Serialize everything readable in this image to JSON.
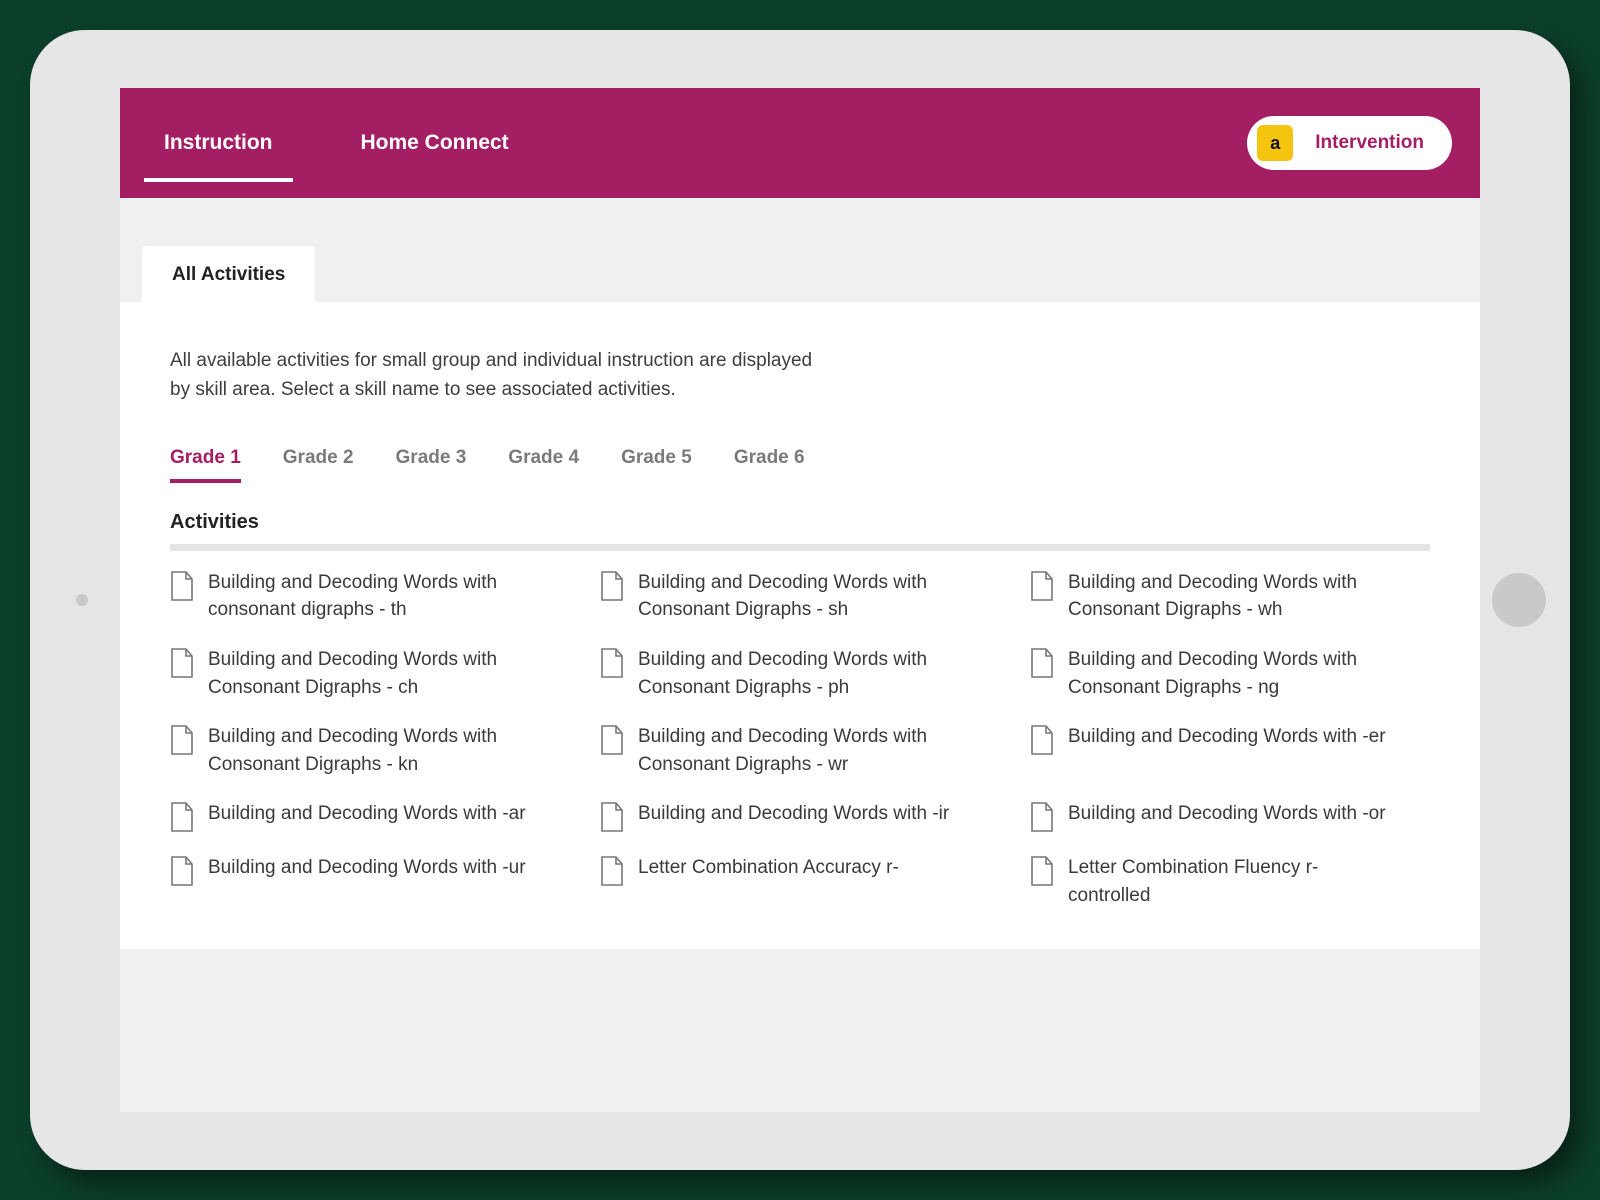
{
  "nav": {
    "tabs": [
      {
        "label": "Instruction",
        "active": true
      },
      {
        "label": "Home Connect",
        "active": false
      }
    ],
    "pill": {
      "badge": "a",
      "label": "Intervention"
    }
  },
  "subtab": {
    "label": "All Activities"
  },
  "intro": "All available activities for small group and individual instruction are displayed by skill area. Select a skill name to see associated activities.",
  "grades": [
    {
      "label": "Grade 1",
      "active": true
    },
    {
      "label": "Grade 2",
      "active": false
    },
    {
      "label": "Grade 3",
      "active": false
    },
    {
      "label": "Grade 4",
      "active": false
    },
    {
      "label": "Grade 5",
      "active": false
    },
    {
      "label": "Grade 6",
      "active": false
    }
  ],
  "section_title": "Activities",
  "activities": [
    "Building and Decoding Words with consonant digraphs - th",
    "Building and Decoding Words with Consonant Digraphs - sh",
    "Building and Decoding Words with Consonant Digraphs - wh",
    "Building and Decoding Words with Consonant Digraphs - ch",
    "Building and Decoding Words with Consonant Digraphs - ph",
    "Building and Decoding Words with Consonant Digraphs - ng",
    "Building and Decoding Words with Consonant Digraphs - kn",
    "Building and Decoding Words with Consonant Digraphs - wr",
    "Building and Decoding Words with -er",
    "Building and Decoding Words with -ar",
    "Building and Decoding Words with -ir",
    "Building and Decoding Words with -or",
    "Building and Decoding Words with -ur",
    "Letter Combination Accuracy r-",
    "Letter Combination Fluency r-controlled"
  ],
  "colors": {
    "brand": "#a41e63",
    "accent": "#f4c40f"
  }
}
